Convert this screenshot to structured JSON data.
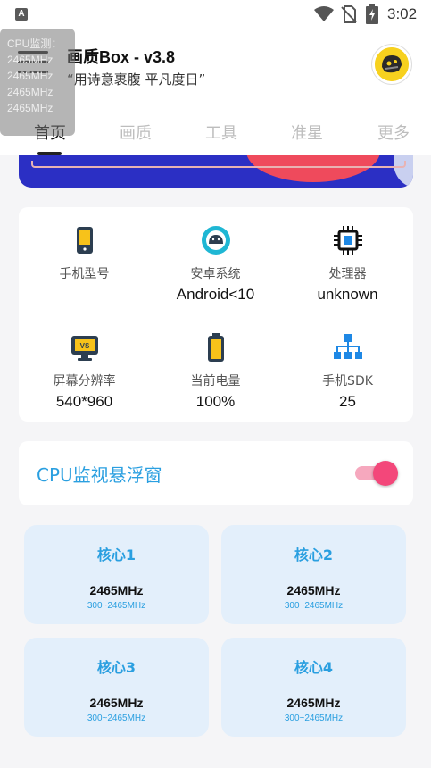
{
  "status_bar": {
    "time": "3:02",
    "notification_letter": "A"
  },
  "header": {
    "title": "画质Box - v3.8",
    "subtitle": "“用诗意裹腹 平凡度日”"
  },
  "tabs": [
    {
      "label": "首页",
      "active": true
    },
    {
      "label": "画质",
      "active": false
    },
    {
      "label": "工具",
      "active": false
    },
    {
      "label": "准星",
      "active": false
    },
    {
      "label": "更多",
      "active": false
    }
  ],
  "overlay": {
    "title": "CPU监测：",
    "lines": [
      "2465MHz",
      "2465MHz",
      "2465MHz",
      "2465MHz"
    ]
  },
  "device_info": [
    {
      "label": "手机型号",
      "value": "",
      "icon": "phone-icon"
    },
    {
      "label": "安卓系统",
      "value": "Android<10",
      "icon": "android-icon"
    },
    {
      "label": "处理器",
      "value": "unknown",
      "icon": "cpu-chip-icon"
    },
    {
      "label": "屏幕分辨率",
      "value": "540*960",
      "icon": "monitor-icon"
    },
    {
      "label": "当前电量",
      "value": "100%",
      "icon": "battery-icon"
    },
    {
      "label": "手机SDK",
      "value": "25",
      "icon": "sdk-network-icon"
    }
  ],
  "cpu_monitor": {
    "label": "CPU监视悬浮窗",
    "enabled": true
  },
  "cores": [
    {
      "name": "核心1",
      "freq": "2465MHz",
      "range": "300~2465MHz"
    },
    {
      "name": "核心2",
      "freq": "2465MHz",
      "range": "300~2465MHz"
    },
    {
      "name": "核心3",
      "freq": "2465MHz",
      "range": "300~2465MHz"
    },
    {
      "name": "核心4",
      "freq": "2465MHz",
      "range": "300~2465MHz"
    }
  ],
  "colors": {
    "accent": "#2a9fe0",
    "toggle_on": "#f3477a",
    "core_bg": "#e3effb"
  }
}
